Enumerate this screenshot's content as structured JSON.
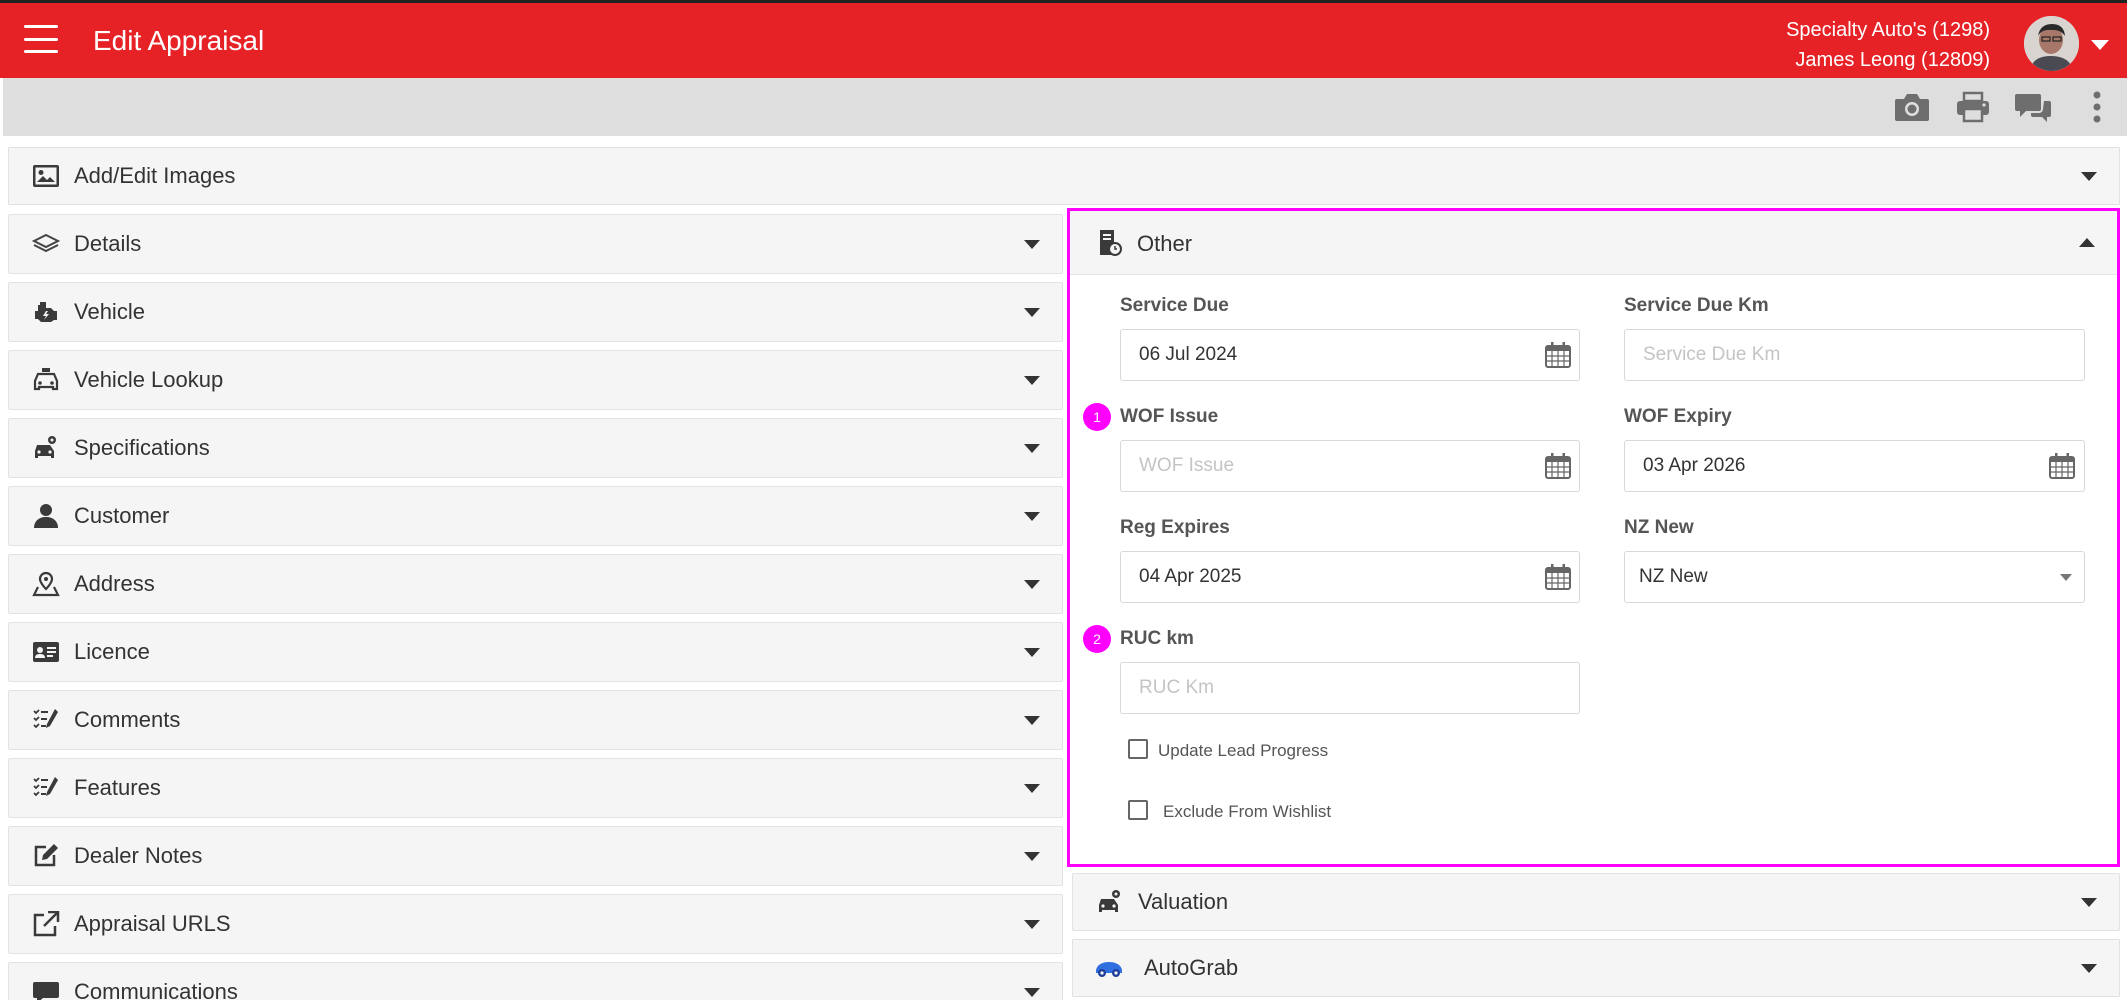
{
  "header": {
    "title": "Edit Appraisal",
    "dealer": "Specialty Auto's (1298)",
    "user": "James Leong (12809)"
  },
  "panels": {
    "images": "Add/Edit Images",
    "left": [
      {
        "key": "details",
        "label": "Details",
        "icon": "layers-icon"
      },
      {
        "key": "vehicle",
        "label": "Vehicle",
        "icon": "engine-icon"
      },
      {
        "key": "vehicle-lookup",
        "label": "Vehicle Lookup",
        "icon": "taxi-icon"
      },
      {
        "key": "specifications",
        "label": "Specifications",
        "icon": "car-cog-icon"
      },
      {
        "key": "customer",
        "label": "Customer",
        "icon": "user-icon"
      },
      {
        "key": "address",
        "label": "Address",
        "icon": "map-pin-icon"
      },
      {
        "key": "licence",
        "label": "Licence",
        "icon": "id-card-icon"
      },
      {
        "key": "comments",
        "label": "Comments",
        "icon": "checklist-pen-icon"
      },
      {
        "key": "features",
        "label": "Features",
        "icon": "checklist-pen-icon"
      },
      {
        "key": "dealer-notes",
        "label": "Dealer Notes",
        "icon": "edit-square-icon"
      },
      {
        "key": "appraisal-urls",
        "label": "Appraisal URLS",
        "icon": "external-link-icon"
      },
      {
        "key": "communications",
        "label": "Communications",
        "icon": "chat-icon"
      }
    ],
    "other": "Other",
    "valuation": "Valuation",
    "autograb": "AutoGrab"
  },
  "other_form": {
    "service_due": {
      "label": "Service Due",
      "value": "06 Jul 2024"
    },
    "service_due_km": {
      "label": "Service Due Km",
      "placeholder": "Service Due Km"
    },
    "wof_issue": {
      "label": "WOF Issue",
      "placeholder": "WOF Issue",
      "badge": "1"
    },
    "wof_expiry": {
      "label": "WOF Expiry",
      "value": "03 Apr 2026"
    },
    "reg_expires": {
      "label": "Reg Expires",
      "value": "04 Apr 2025"
    },
    "nz_new": {
      "label": "NZ New",
      "value": "NZ New"
    },
    "ruc_km": {
      "label": "RUC km",
      "placeholder": "RUC Km",
      "badge": "2"
    },
    "update_lead_progress": "Update Lead Progress",
    "exclude_from_wishlist": "Exclude From Wishlist"
  },
  "colors": {
    "header": "#e62227",
    "highlight": "#ff00ff",
    "toolbar": "#dedede",
    "panel": "#f5f5f5"
  }
}
